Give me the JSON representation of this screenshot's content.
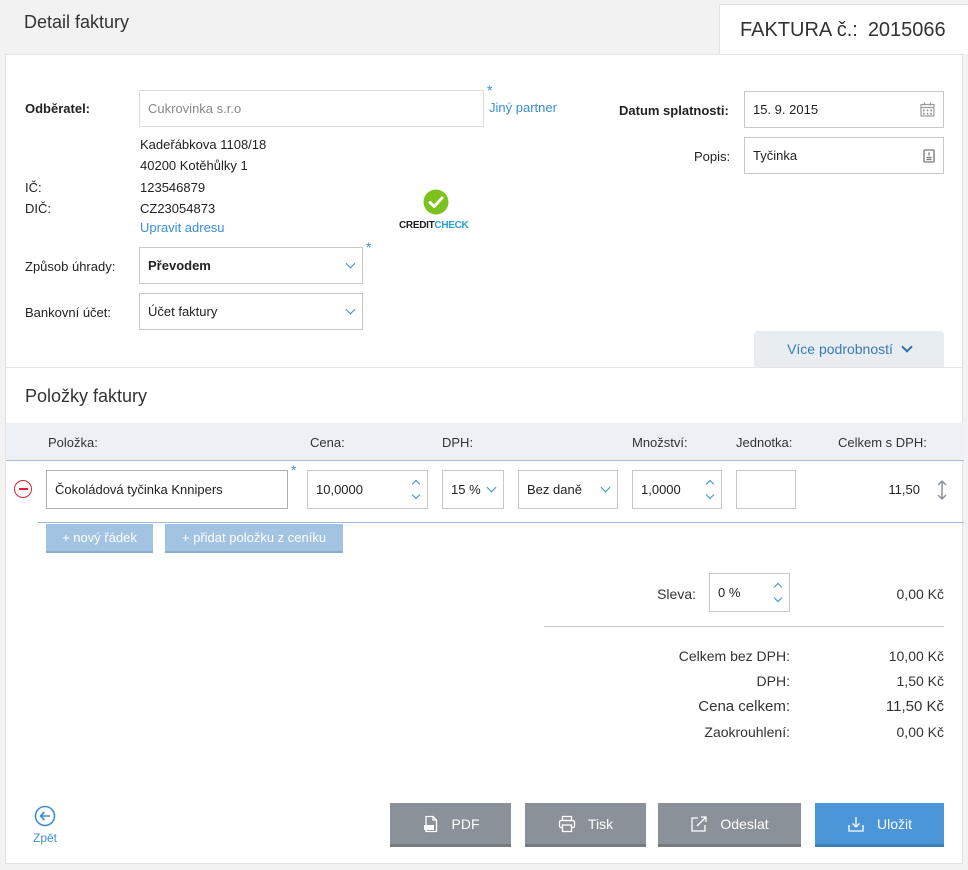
{
  "header": {
    "title": "Detail faktury",
    "invoice_label": "FAKTURA č.:",
    "invoice_number": "2015066"
  },
  "customer": {
    "label": "Odběratel:",
    "placeholder": "Cukrovinka s.r.o",
    "other_partner": "Jiný partner",
    "street": "Kadeřábkova 1108/18",
    "city": "40200 Kotěhůlky 1",
    "ic_label": "IČ:",
    "ic": "123546879",
    "dic_label": "DIČ:",
    "dic": "CZ23054873",
    "edit_address": "Upravit adresu",
    "creditcheck_a": "CREDIT",
    "creditcheck_b": "CHECK"
  },
  "payment": {
    "method_label": "Způsob úhrady:",
    "method_value": "Převodem",
    "account_label": "Bankovní účet:",
    "account_value": "Účet faktury"
  },
  "due": {
    "label": "Datum splatnosti:",
    "value": "15. 9. 2015"
  },
  "description": {
    "label": "Popis:",
    "value": "Tyčinka"
  },
  "more_details": "Více podrobností",
  "items": {
    "title": "Položky faktury",
    "columns": {
      "item": "Položka:",
      "price": "Cena:",
      "vat": "DPH:",
      "qty": "Množství:",
      "unit": "Jednotka:",
      "total": "Celkem s DPH:"
    },
    "rows": [
      {
        "name": "Čokoládová tyčinka Knnipers",
        "price": "10,0000",
        "vat": "15 %",
        "vat_type": "Bez daně",
        "qty": "1,0000",
        "unit": "",
        "total": "11,50"
      }
    ],
    "new_row": "+ nový řádek",
    "add_from_list": "+ přidat položku z ceníku"
  },
  "totals": {
    "discount_label": "Sleva:",
    "discount_value": "0 %",
    "discount_amount": "0,00 Kč",
    "net_label": "Celkem bez DPH:",
    "net_value": "10,00 Kč",
    "vat_label": "DPH:",
    "vat_value": "1,50 Kč",
    "total_label": "Cena celkem:",
    "total_value": "11,50 Kč",
    "rounding_label": "Zaokrouhlení:",
    "rounding_value": "0,00 Kč"
  },
  "actions": {
    "back": "Zpět",
    "pdf": "PDF",
    "print": "Tisk",
    "send": "Odeslat",
    "save": "Uložit"
  },
  "colors": {
    "accent": "#3a8ed4",
    "save": "#4a96d8",
    "gray_button": "#8a9198"
  }
}
